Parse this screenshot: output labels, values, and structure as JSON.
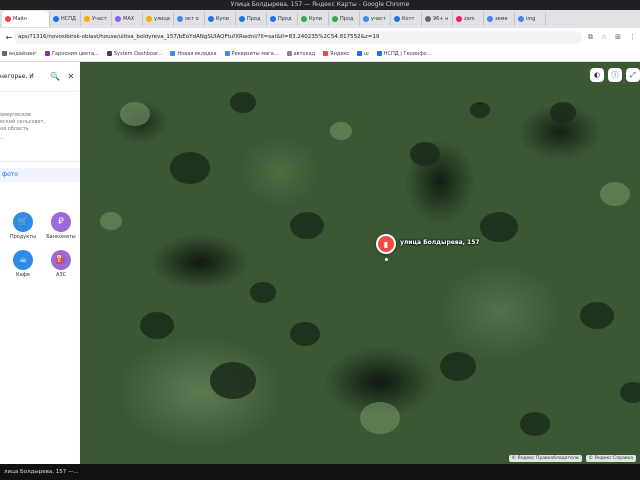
{
  "window": {
    "title": "Улица Болдырева, 157 — Яндекс Карты - Google Chrome"
  },
  "tabs": [
    {
      "label": "Майл",
      "color": "#e44"
    },
    {
      "label": "НСПД",
      "color": "#1a73e8"
    },
    {
      "label": "Участ",
      "color": "#f9ab00"
    },
    {
      "label": "MAX",
      "color": "#8a5cf6"
    },
    {
      "label": "улица",
      "color": "#f9ab00"
    },
    {
      "label": "окт о",
      "color": "#4285f4"
    },
    {
      "label": "Купи",
      "color": "#1a73e8"
    },
    {
      "label": "Прод",
      "color": "#1a73e8"
    },
    {
      "label": "Прод",
      "color": "#1a73e8"
    },
    {
      "label": "Купи",
      "color": "#34a853"
    },
    {
      "label": "Прод",
      "color": "#34a853"
    },
    {
      "label": "участ",
      "color": "#4285f4"
    },
    {
      "label": "Котт",
      "color": "#1a73e8"
    },
    {
      "label": "96+ н",
      "color": "#666"
    },
    {
      "label": "zam",
      "color": "#e91e63"
    },
    {
      "label": "земе",
      "color": "#4285f4"
    },
    {
      "label": "img",
      "color": "#4285f4"
    }
  ],
  "address_bar": {
    "url": "aps/?1316/novosibirsk-oblast/house/ulitsa_boldyreva_157/bEoYdANgSUIAQFtufXRwdnl/?ll=sat&ll=83.240235%2C54.817552&z=19"
  },
  "bookmarks": [
    {
      "label": "ендайзинг",
      "color": "#666"
    },
    {
      "label": "Гарнония цвета...",
      "color": "#9c27b0"
    },
    {
      "label": "System Dashboar...",
      "color": "#444"
    },
    {
      "label": "Новая вкладка",
      "color": "#4285f4"
    },
    {
      "label": "Реквизиты мага...",
      "color": "#4285f4"
    },
    {
      "label": "автокад",
      "color": "#888"
    },
    {
      "label": "Яндекс",
      "color": "#e44"
    },
    {
      "label": "ш",
      "color": "#1a73e8"
    },
    {
      "label": "НСПД | Геоинфо...",
      "color": "#1a73e8"
    }
  ],
  "sidebar": {
    "search_text": "негорье, И",
    "address_lines": [
      "омерческое",
      "вский сельсовет,",
      "ая область"
    ],
    "more_link": "...",
    "photo_button": "фото",
    "pois": [
      {
        "label": "Продукты",
        "icon": "shopping-basket-icon",
        "glyph": "🛒",
        "color": "#2d8ae6"
      },
      {
        "label": "Банкоматы",
        "icon": "ruble-icon",
        "glyph": "₽",
        "color": "#9b6ad6"
      },
      {
        "label": "Кафе",
        "icon": "cup-icon",
        "glyph": "☕",
        "color": "#2d8ae6"
      },
      {
        "label": "АЗС",
        "icon": "fuel-icon",
        "glyph": "⛽",
        "color": "#9b6ad6"
      }
    ]
  },
  "map": {
    "pin_label": "улица Болдырева, 157",
    "copyright_yandex": "© Яндекс  Правообладатели",
    "copyright_terms": "© Яндекс  Справка"
  },
  "taskbar": {
    "label": "лица Болдырева, 157 —..."
  }
}
